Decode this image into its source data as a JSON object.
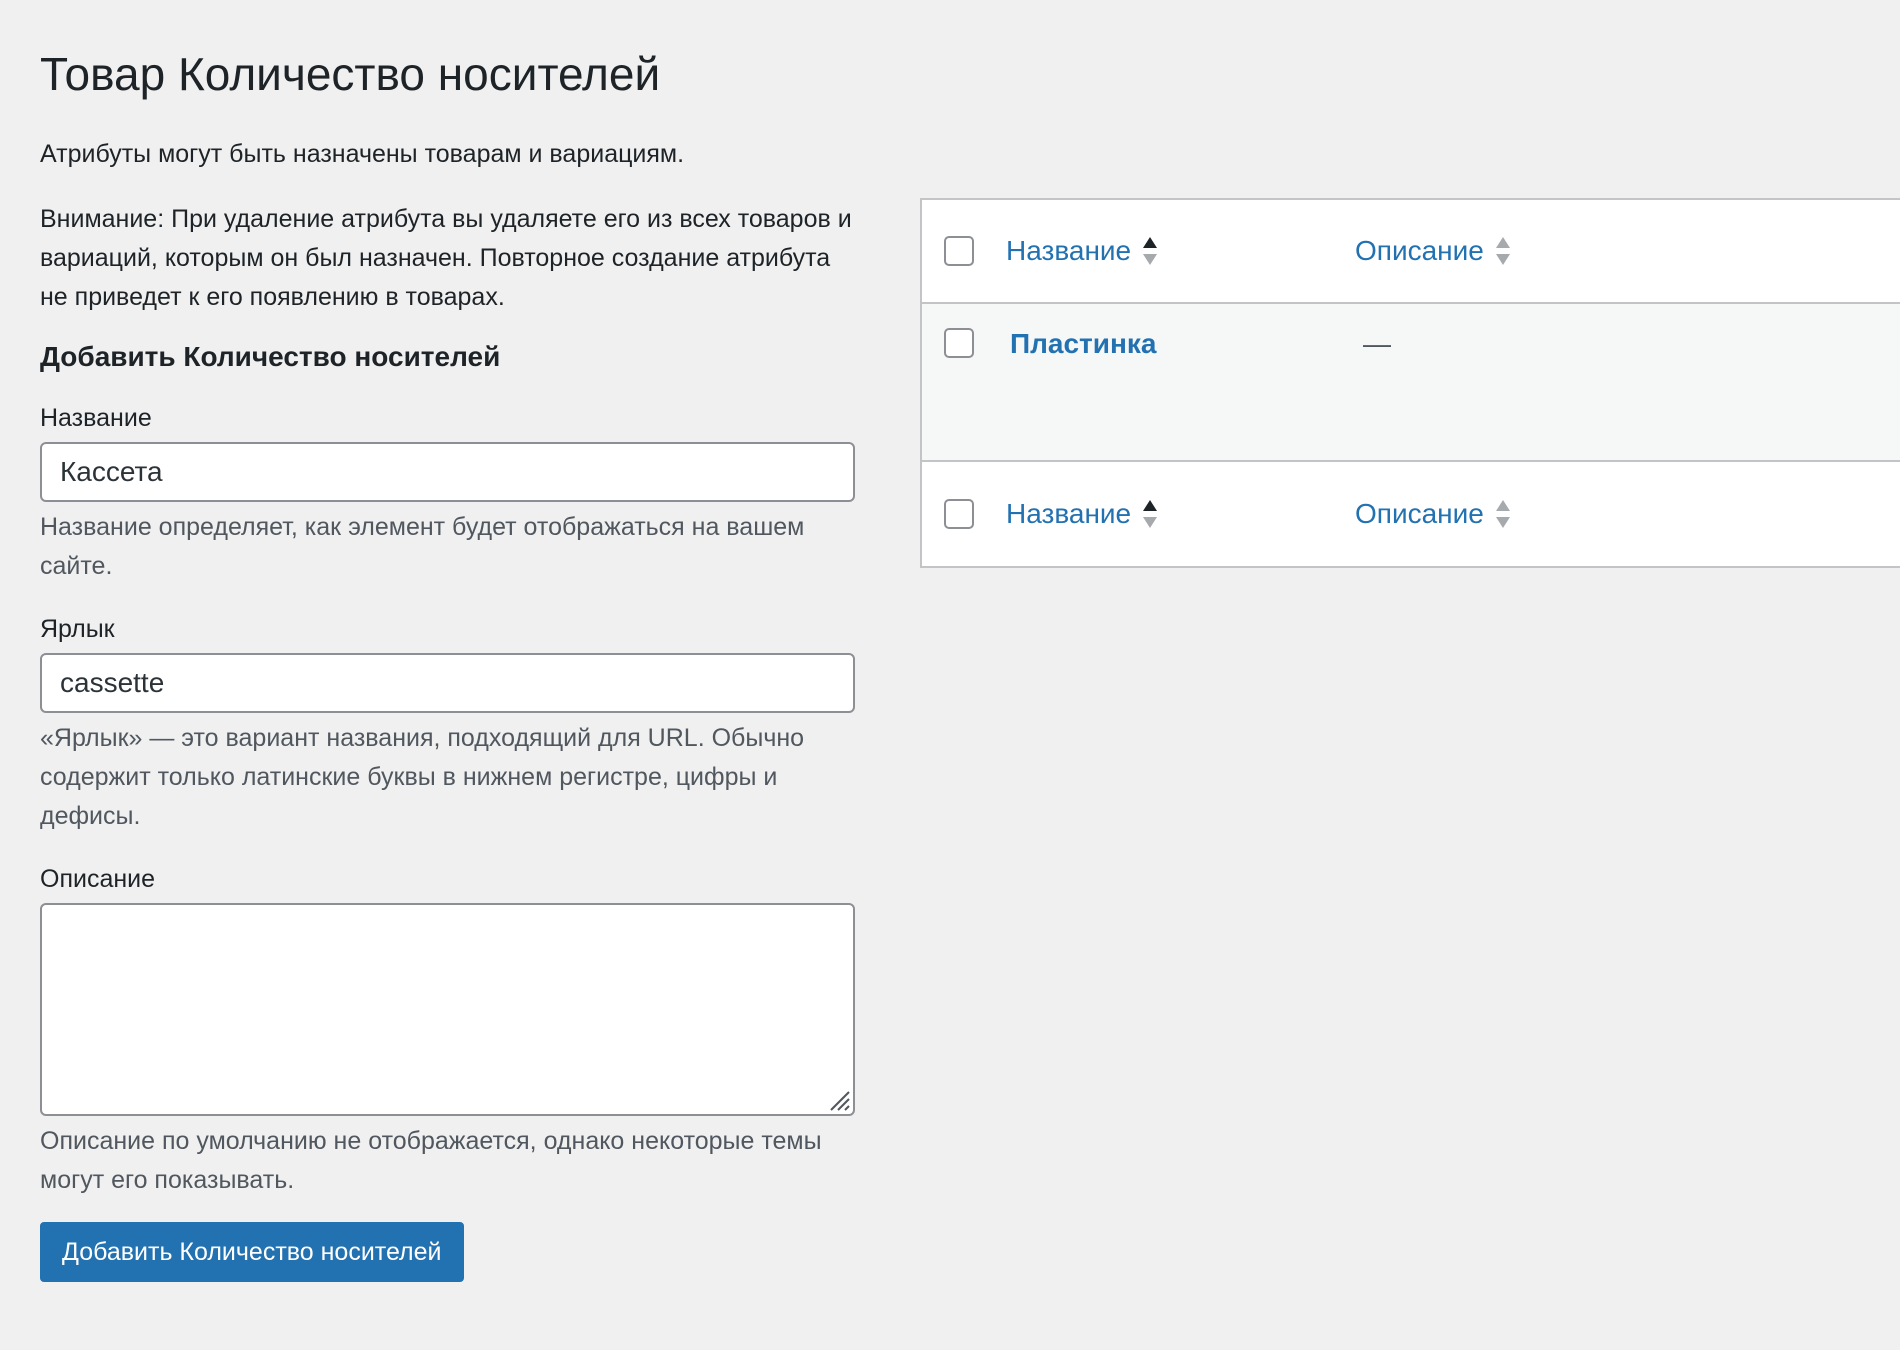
{
  "page": {
    "title": "Товар Количество носителей"
  },
  "intro": {
    "line1": "Атрибуты могут быть назначены товарам и вариациям.",
    "line2": "Внимание: При удаление атрибута вы удаляете его из всех товаров и вариаций, которым он был назначен. Повторное создание атрибута не приведет к его появлению в товарах."
  },
  "form": {
    "title": "Добавить Количество носителей",
    "name": {
      "label": "Название",
      "value": "Кассета",
      "help": "Название определяет, как элемент будет отображаться на вашем сайте."
    },
    "slug": {
      "label": "Ярлык",
      "value": "cassette",
      "help": "«Ярлык» — это вариант названия, подходящий для URL. Обычно содержит только латинские буквы в нижнем регистре, цифры и дефисы."
    },
    "description": {
      "label": "Описание",
      "value": "",
      "help": "Описание по умолчанию не отображается, однако некоторые темы могут его показывать."
    },
    "submit_label": "Добавить Количество носителей"
  },
  "table": {
    "columns": {
      "name": "Название",
      "description": "Описание"
    },
    "sort": {
      "name": "asc",
      "description": "none"
    },
    "rows": [
      {
        "name": "Пластинка",
        "description": "—"
      }
    ]
  },
  "colors": {
    "background": "#f0f0f1",
    "link": "#2271b1",
    "primary_button": "#2271b1",
    "border": "#c3c4c7",
    "help_text": "#50575e"
  }
}
